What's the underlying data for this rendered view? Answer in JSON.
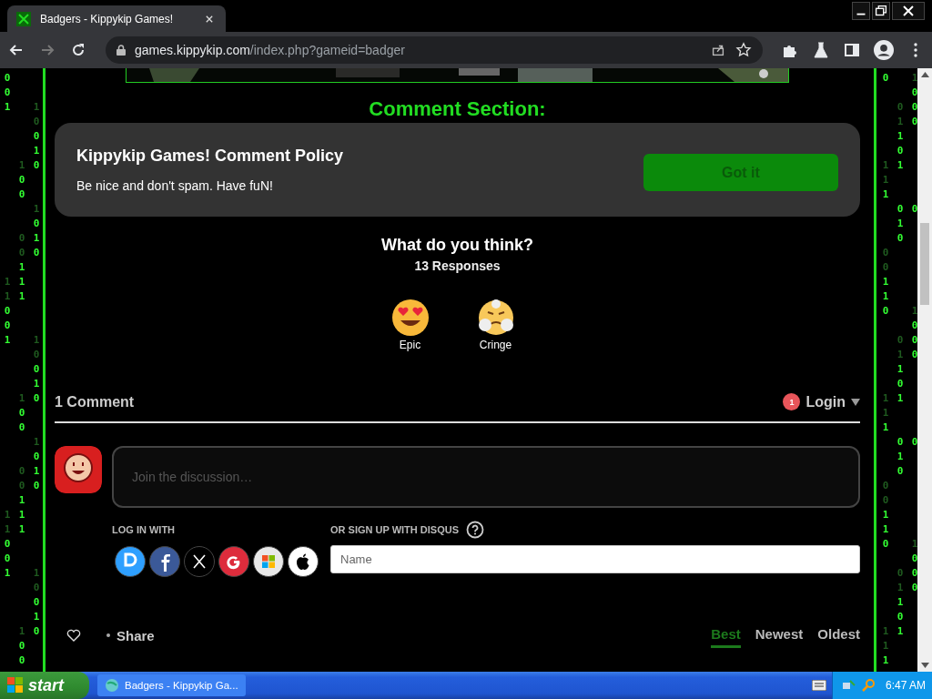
{
  "browser": {
    "tab_title": "Badgers - Kippykip Games!",
    "url_host": "games.kippykip.com",
    "url_path": "/index.php?gameid=badger"
  },
  "rain_left": [
    {
      "left": {
        "d": "0",
        "dim": false
      }
    },
    {
      "left": {
        "d": "0",
        "dim": false
      }
    },
    {
      "left": {
        "d": "1",
        "dim": false
      },
      "right": {
        "d": "1",
        "dim": true
      }
    },
    {
      "right": {
        "d": "0",
        "dim": true
      }
    },
    {
      "right": {
        "d": "0",
        "dim": false
      }
    },
    {
      "right": {
        "d": "1",
        "dim": false
      }
    },
    {
      "middle": {
        "d": "1",
        "dim": true
      },
      "right": {
        "d": "0",
        "dim": false
      }
    },
    {
      "middle": {
        "d": "0",
        "dim": false
      }
    },
    {
      "middle": {
        "d": "0",
        "dim": false
      }
    },
    {
      "right": {
        "d": "1",
        "dim": true
      }
    },
    {
      "right": {
        "d": "0",
        "dim": false
      }
    },
    {
      "middle": {
        "d": "0",
        "dim": true
      },
      "right": {
        "d": "1",
        "dim": false
      }
    },
    {
      "middle": {
        "d": "0",
        "dim": true
      },
      "right": {
        "d": "0",
        "dim": false
      }
    },
    {
      "middle": {
        "d": "1",
        "dim": false
      }
    },
    {
      "left": {
        "d": "1",
        "dim": true
      },
      "middle": {
        "d": "1",
        "dim": false
      }
    },
    {
      "left": {
        "d": "1",
        "dim": true
      },
      "middle": {
        "d": "1",
        "dim": false
      }
    },
    {
      "left": {
        "d": "0",
        "dim": false
      }
    },
    {
      "left": {
        "d": "0",
        "dim": false
      }
    },
    {
      "left": {
        "d": "1",
        "dim": false
      },
      "right": {
        "d": "1",
        "dim": true
      }
    },
    {
      "right": {
        "d": "0",
        "dim": true
      }
    },
    {
      "right": {
        "d": "0",
        "dim": false
      }
    },
    {
      "right": {
        "d": "1",
        "dim": false
      }
    },
    {
      "middle": {
        "d": "1",
        "dim": true
      },
      "right": {
        "d": "0",
        "dim": false
      }
    },
    {
      "middle": {
        "d": "0",
        "dim": false
      }
    },
    {
      "middle": {
        "d": "0",
        "dim": false
      }
    },
    {
      "right": {
        "d": "1",
        "dim": true
      }
    },
    {
      "right": {
        "d": "0",
        "dim": false
      }
    },
    {
      "middle": {
        "d": "0",
        "dim": true
      },
      "right": {
        "d": "1",
        "dim": false
      }
    },
    {
      "middle": {
        "d": "0",
        "dim": true
      },
      "right": {
        "d": "0",
        "dim": false
      }
    },
    {
      "middle": {
        "d": "1",
        "dim": false
      }
    },
    {
      "left": {
        "d": "1",
        "dim": true
      },
      "middle": {
        "d": "1",
        "dim": false
      }
    },
    {
      "left": {
        "d": "1",
        "dim": true
      },
      "middle": {
        "d": "1",
        "dim": false
      }
    },
    {
      "left": {
        "d": "0",
        "dim": false
      }
    },
    {
      "left": {
        "d": "0",
        "dim": false
      }
    },
    {
      "left": {
        "d": "1",
        "dim": false
      },
      "right": {
        "d": "1",
        "dim": true
      }
    },
    {
      "right": {
        "d": "0",
        "dim": true
      }
    },
    {
      "right": {
        "d": "0",
        "dim": false
      }
    },
    {
      "right": {
        "d": "1",
        "dim": false
      }
    },
    {
      "middle": {
        "d": "1",
        "dim": true
      },
      "right": {
        "d": "0",
        "dim": false
      }
    },
    {
      "middle": {
        "d": "0",
        "dim": false
      }
    },
    {
      "middle": {
        "d": "0",
        "dim": false
      }
    }
  ],
  "rain_right": [
    {
      "left": {
        "d": "0",
        "dim": false
      },
      "right": {
        "d": "1",
        "dim": true
      }
    },
    {
      "right": {
        "d": "0",
        "dim": false
      }
    },
    {
      "middle": {
        "d": "0",
        "dim": true
      },
      "right": {
        "d": "0",
        "dim": false
      }
    },
    {
      "middle": {
        "d": "1",
        "dim": true
      },
      "right": {
        "d": "0",
        "dim": false
      }
    },
    {
      "middle": {
        "d": "1",
        "dim": false
      }
    },
    {
      "middle": {
        "d": "0",
        "dim": false
      }
    },
    {
      "left": {
        "d": "1",
        "dim": true
      },
      "middle": {
        "d": "1",
        "dim": false
      }
    },
    {
      "left": {
        "d": "1",
        "dim": true
      }
    },
    {
      "left": {
        "d": "1",
        "dim": false
      }
    },
    {
      "middle": {
        "d": "0",
        "dim": false
      },
      "right": {
        "d": "0",
        "dim": false
      }
    },
    {
      "middle": {
        "d": "1",
        "dim": false
      }
    },
    {
      "middle": {
        "d": "0",
        "dim": false
      }
    },
    {
      "left": {
        "d": "0",
        "dim": true
      }
    },
    {
      "left": {
        "d": "0",
        "dim": true
      }
    },
    {
      "left": {
        "d": "1",
        "dim": false
      }
    },
    {
      "left": {
        "d": "1",
        "dim": false
      }
    },
    {
      "left": {
        "d": "0",
        "dim": false
      },
      "right": {
        "d": "1",
        "dim": true
      }
    },
    {
      "right": {
        "d": "0",
        "dim": false
      }
    },
    {
      "middle": {
        "d": "0",
        "dim": true
      },
      "right": {
        "d": "0",
        "dim": false
      }
    },
    {
      "middle": {
        "d": "1",
        "dim": true
      },
      "right": {
        "d": "0",
        "dim": false
      }
    },
    {
      "middle": {
        "d": "1",
        "dim": false
      }
    },
    {
      "middle": {
        "d": "0",
        "dim": false
      }
    },
    {
      "left": {
        "d": "1",
        "dim": true
      },
      "middle": {
        "d": "1",
        "dim": false
      }
    },
    {
      "left": {
        "d": "1",
        "dim": true
      }
    },
    {
      "left": {
        "d": "1",
        "dim": false
      }
    },
    {
      "middle": {
        "d": "0",
        "dim": false
      },
      "right": {
        "d": "0",
        "dim": false
      }
    },
    {
      "middle": {
        "d": "1",
        "dim": false
      }
    },
    {
      "middle": {
        "d": "0",
        "dim": false
      }
    },
    {
      "left": {
        "d": "0",
        "dim": true
      }
    },
    {
      "left": {
        "d": "0",
        "dim": true
      }
    },
    {
      "left": {
        "d": "1",
        "dim": false
      }
    },
    {
      "left": {
        "d": "1",
        "dim": false
      }
    },
    {
      "left": {
        "d": "0",
        "dim": false
      },
      "right": {
        "d": "1",
        "dim": true
      }
    },
    {
      "right": {
        "d": "0",
        "dim": false
      }
    },
    {
      "middle": {
        "d": "0",
        "dim": true
      },
      "right": {
        "d": "0",
        "dim": false
      }
    },
    {
      "middle": {
        "d": "1",
        "dim": true
      },
      "right": {
        "d": "0",
        "dim": false
      }
    },
    {
      "middle": {
        "d": "1",
        "dim": false
      }
    },
    {
      "middle": {
        "d": "0",
        "dim": false
      }
    },
    {
      "left": {
        "d": "1",
        "dim": true
      },
      "middle": {
        "d": "1",
        "dim": false
      }
    },
    {
      "left": {
        "d": "1",
        "dim": true
      }
    },
    {
      "left": {
        "d": "1",
        "dim": false
      }
    }
  ],
  "page": {
    "heading": "Comment Section:",
    "policy": {
      "title": "Kippykip Games! Comment Policy",
      "text": "Be nice and don't spam. Have fuN!",
      "button": "Got it"
    },
    "reactions": {
      "question": "What do you think?",
      "responses": "13 Responses",
      "items": [
        {
          "label": "Epic",
          "kind": "hearteyes"
        },
        {
          "label": "Cringe",
          "kind": "steaming"
        }
      ]
    },
    "comments": {
      "count": "1 Comment",
      "login": "Login",
      "badge": "1"
    },
    "composer": {
      "placeholder": "Join the discussion…",
      "login_with": "LOG IN WITH",
      "signup": "OR SIGN UP WITH DISQUS",
      "name_placeholder": "Name"
    },
    "sort": {
      "share": "Share",
      "tabs": [
        {
          "label": "Best",
          "selected": true
        },
        {
          "label": "Newest",
          "selected": false
        },
        {
          "label": "Oldest",
          "selected": false
        }
      ]
    }
  },
  "taskbar": {
    "start": "start",
    "window": "Badgers - Kippykip Ga...",
    "clock": "6:47 AM"
  }
}
